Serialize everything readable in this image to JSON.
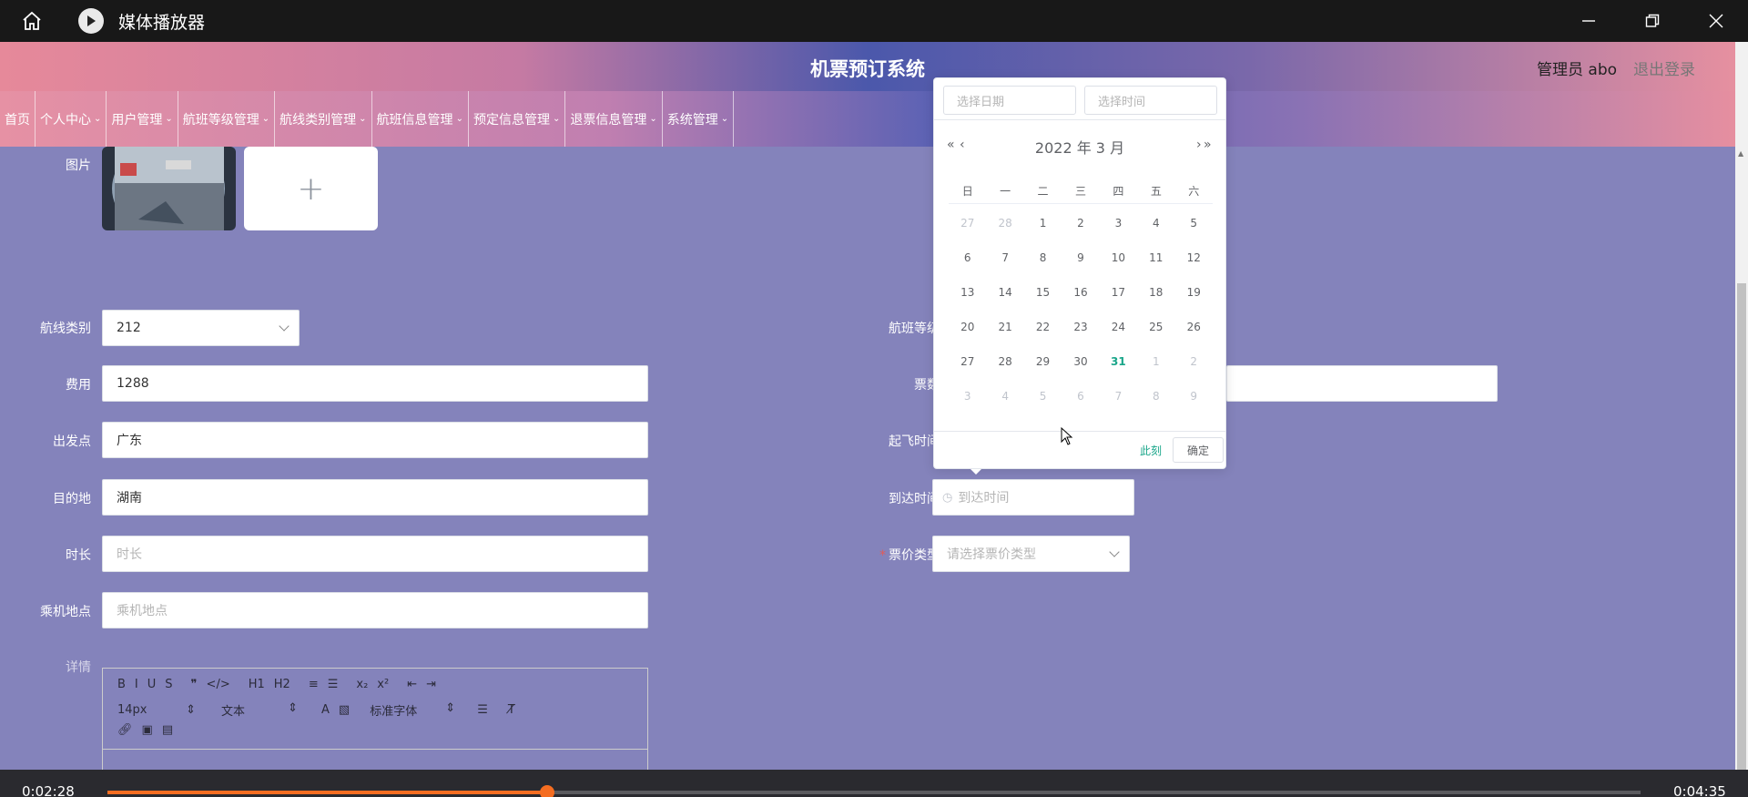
{
  "player": {
    "title": "媒体播放器",
    "time_current": "0:02:28",
    "time_total": "0:04:35",
    "progress": 0.287
  },
  "app": {
    "title": "机票预订系统",
    "admin_label": "管理员 abo",
    "logout": "退出登录"
  },
  "nav": {
    "items": [
      {
        "label": "首页",
        "has_menu": false
      },
      {
        "label": "个人中心",
        "has_menu": true
      },
      {
        "label": "用户管理",
        "has_menu": true
      },
      {
        "label": "航班等级管理",
        "has_menu": true
      },
      {
        "label": "航线类别管理",
        "has_menu": true
      },
      {
        "label": "航班信息管理",
        "has_menu": true
      },
      {
        "label": "预定信息管理",
        "has_menu": true
      },
      {
        "label": "退票信息管理",
        "has_menu": true
      },
      {
        "label": "系统管理",
        "has_menu": true
      }
    ]
  },
  "form": {
    "image_label": "图片",
    "upload_plus": "+",
    "route_category": {
      "label": "航线类别",
      "value": "212"
    },
    "flight_class": {
      "label": "航班等级"
    },
    "fee": {
      "label": "费用",
      "value": "1288"
    },
    "tickets": {
      "label": "票数"
    },
    "departure": {
      "label": "出发点",
      "value": "广东"
    },
    "takeoff_time": {
      "label": "起飞时间"
    },
    "destination": {
      "label": "目的地",
      "value": "湖南"
    },
    "arrival_time": {
      "label": "到达时间",
      "placeholder": "到达时间"
    },
    "duration": {
      "label": "时长",
      "placeholder": "时长"
    },
    "ticket_type": {
      "label": "票价类型",
      "placeholder": "请选择票价类型"
    },
    "boarding": {
      "label": "乘机地点",
      "placeholder": "乘机地点"
    },
    "details": {
      "label": "详情"
    }
  },
  "editor": {
    "row1": [
      "B",
      "I",
      "U",
      "S",
      "❞",
      "</>",
      "H1",
      "H2",
      "≡",
      "☰",
      "x₂",
      "x²",
      "⇤",
      "⇥"
    ],
    "font_size": "14px",
    "text_type": "文本",
    "font_family": "标准字体",
    "row3_icons": [
      "link-icon",
      "image-icon",
      "video-icon"
    ]
  },
  "datepicker": {
    "date_placeholder": "选择日期",
    "time_placeholder": "选择时间",
    "year_month": "2022 年  3 月",
    "weekdays": [
      "日",
      "一",
      "二",
      "三",
      "四",
      "五",
      "六"
    ],
    "weeks": [
      [
        {
          "d": "27",
          "o": true
        },
        {
          "d": "28",
          "o": true
        },
        {
          "d": "1"
        },
        {
          "d": "2"
        },
        {
          "d": "3"
        },
        {
          "d": "4"
        },
        {
          "d": "5"
        }
      ],
      [
        {
          "d": "6"
        },
        {
          "d": "7"
        },
        {
          "d": "8"
        },
        {
          "d": "9"
        },
        {
          "d": "10"
        },
        {
          "d": "11"
        },
        {
          "d": "12"
        }
      ],
      [
        {
          "d": "13"
        },
        {
          "d": "14"
        },
        {
          "d": "15"
        },
        {
          "d": "16"
        },
        {
          "d": "17"
        },
        {
          "d": "18"
        },
        {
          "d": "19"
        }
      ],
      [
        {
          "d": "20"
        },
        {
          "d": "21"
        },
        {
          "d": "22"
        },
        {
          "d": "23"
        },
        {
          "d": "24"
        },
        {
          "d": "25"
        },
        {
          "d": "26"
        }
      ],
      [
        {
          "d": "27"
        },
        {
          "d": "28"
        },
        {
          "d": "29"
        },
        {
          "d": "30"
        },
        {
          "d": "31",
          "today": true
        },
        {
          "d": "1",
          "o": true
        },
        {
          "d": "2",
          "o": true
        }
      ],
      [
        {
          "d": "3",
          "o": true
        },
        {
          "d": "4",
          "o": true
        },
        {
          "d": "5",
          "o": true
        },
        {
          "d": "6",
          "o": true
        },
        {
          "d": "7",
          "o": true
        },
        {
          "d": "8",
          "o": true
        },
        {
          "d": "9",
          "o": true
        }
      ]
    ],
    "now_label": "此刻",
    "ok_label": "确定"
  },
  "colors": {
    "content_bg": "#8483bb",
    "accent_green": "#1aa68a",
    "progress_orange": "#f56d21"
  }
}
